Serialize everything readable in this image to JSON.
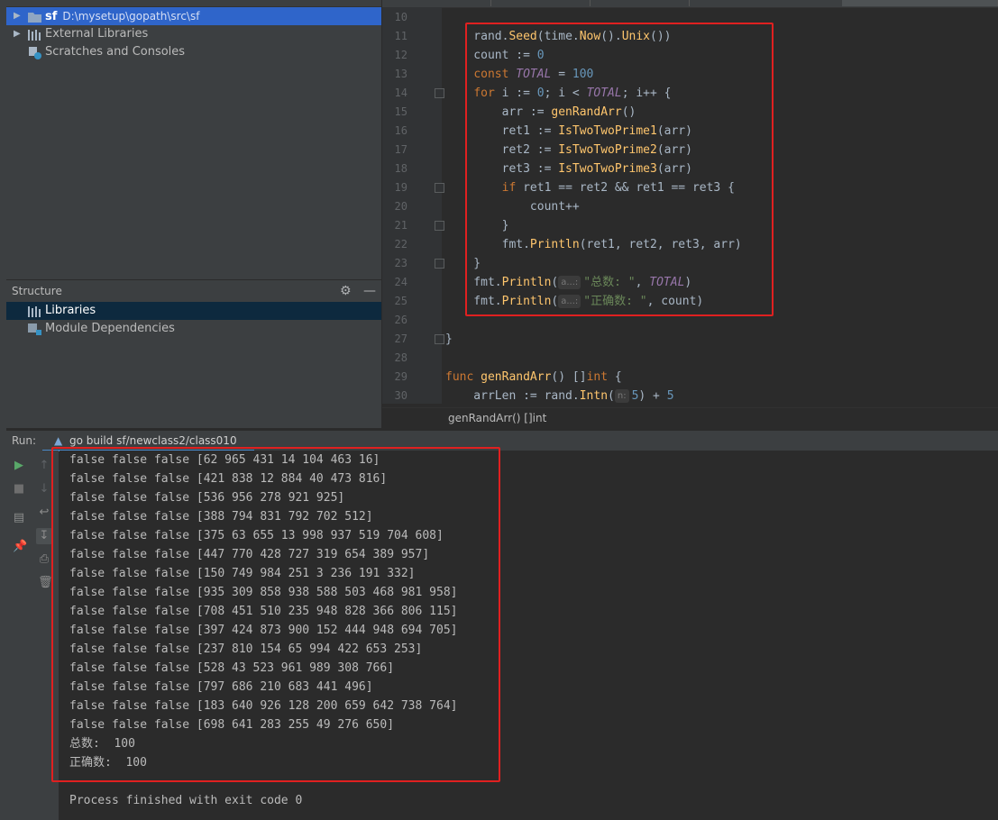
{
  "project": {
    "rows": [
      {
        "label": "sf",
        "sub": "D:\\mysetup\\gopath\\src\\sf"
      },
      {
        "label": "External Libraries"
      },
      {
        "label": "Scratches and Consoles"
      }
    ]
  },
  "structure": {
    "title": "Structure",
    "items": [
      "Libraries",
      "Module Dependencies"
    ]
  },
  "editor": {
    "breadcrumb": "genRandArr() []int"
  },
  "run": {
    "label": "Run:",
    "config": "go build sf/newclass2/class010",
    "output": [
      "false false false [62 965 431 14 104 463 16]",
      "false false false [421 838 12 884 40 473 816]",
      "false false false [536 956 278 921 925]",
      "false false false [388 794 831 792 702 512]",
      "false false false [375 63 655 13 998 937 519 704 608]",
      "false false false [447 770 428 727 319 654 389 957]",
      "false false false [150 749 984 251 3 236 191 332]",
      "false false false [935 309 858 938 588 503 468 981 958]",
      "false false false [708 451 510 235 948 828 366 806 115]",
      "false false false [397 424 873 900 152 444 948 694 705]",
      "false false false [237 810 154 65 994 422 653 253]",
      "false false false [528 43 523 961 989 308 766]",
      "false false false [797 686 210 683 441 496]",
      "false false false [183 640 926 128 200 659 642 738 764]",
      "false false false [698 641 283 255 49 276 650]",
      "总数:  100",
      "正确数:  100"
    ],
    "exit_message": "Process finished with exit code 0"
  }
}
